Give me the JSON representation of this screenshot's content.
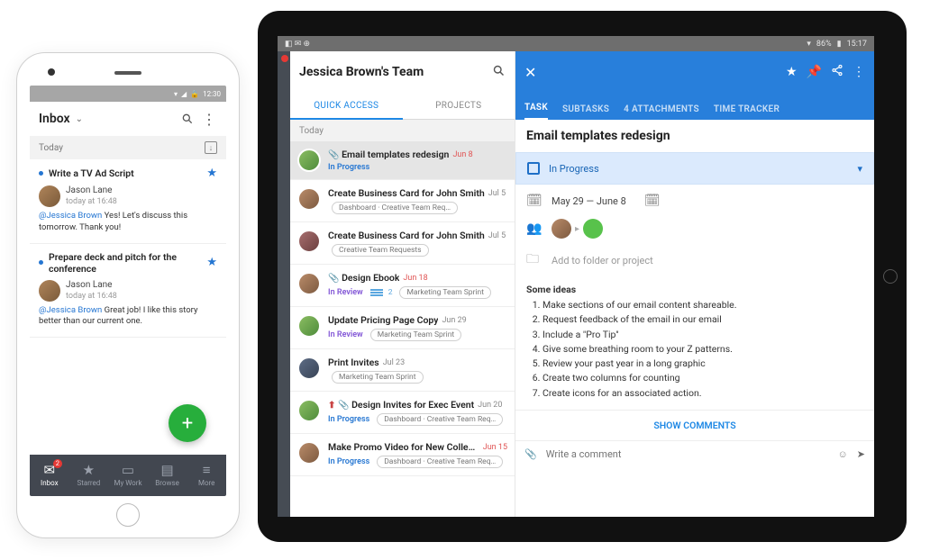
{
  "phone": {
    "status_time": "12:30",
    "header_title": "Inbox",
    "search_icon": "search",
    "more_icon": "more",
    "today_label": "Today",
    "items": [
      {
        "title": "Write a TV Ad Script",
        "author": "Jason Lane",
        "time": "today at 16:48",
        "mention": "@Jessica Brown",
        "message": " Yes! Let's discuss this tomorrow. Thank you!"
      },
      {
        "title": "Prepare deck and pitch for the conference",
        "author": "Jason Lane",
        "time": "today at 16:48",
        "mention": "@Jessica Brown",
        "message": " Great job! I like this story better than our current one."
      }
    ],
    "nav": {
      "inbox": "Inbox",
      "inbox_badge": "2",
      "starred": "Starred",
      "mywork": "My Work",
      "browse": "Browse",
      "more": "More"
    }
  },
  "tablet": {
    "status": {
      "battery": "86%",
      "time": "15:17"
    },
    "team_title": "Jessica Brown's Team",
    "tabs": {
      "quick": "QUICK ACCESS",
      "projects": "PROJECTS"
    },
    "today_label": "Today",
    "tasks": [
      {
        "title": "Email templates redesign",
        "date": "Jun 8",
        "date_red": true,
        "status": "In Progress",
        "status_cls": "inprogress",
        "has_clip": true,
        "avatar": "a1"
      },
      {
        "title": "Create Business Card for John Smith",
        "date": "Jul 5",
        "has_pill": true,
        "pill": "Dashboard · Creative Team Requests",
        "avatar": "a2"
      },
      {
        "title": "Create Business Card for John Smith",
        "date": "Jul 5",
        "has_pill": true,
        "pill": "Creative Team Requests",
        "avatar": "a3"
      },
      {
        "title": "Design Ebook",
        "date": "Jun 18",
        "date_red": true,
        "status": "In Review",
        "status_cls": "inreview",
        "has_clip": true,
        "has_lines": true,
        "lines_count": "2",
        "has_pill": true,
        "pill": "Marketing Team Sprint",
        "avatar": "a2"
      },
      {
        "title": "Update Pricing Page Copy",
        "date": "Jun 29",
        "status": "In Review",
        "status_cls": "inreview",
        "has_pill": true,
        "pill": "Marketing Team Sprint",
        "avatar": "a1"
      },
      {
        "title": "Print Invites",
        "date": "Jul 23",
        "has_pill": true,
        "pill": "Marketing Team Sprint",
        "avatar": "a4"
      },
      {
        "title": "Design Invites for Exec Event",
        "date": "Jun 20",
        "status": "In Progress",
        "status_cls": "inprogress",
        "has_pin": true,
        "has_clip": true,
        "has_pill": true,
        "pill": "Dashboard · Creative Team Requ…",
        "avatar": "a1"
      },
      {
        "title": "Make Promo Video for New Collection",
        "date": "Jun 15",
        "date_red": true,
        "status": "In Progress",
        "status_cls": "inprogress",
        "has_pill": true,
        "pill": "Dashboard · Creative Team Requ…",
        "avatar": "a2"
      }
    ],
    "detail": {
      "tabs": {
        "task": "TASK",
        "subtasks": "SUBTASKS",
        "attachments": "4 ATTACHMENTS",
        "timetracker": "TIME TRACKER"
      },
      "title": "Email templates redesign",
      "status": "In Progress",
      "dates": "May 29 — June 8",
      "folder_placeholder": "Add to folder or project",
      "ideas_header": "Some ideas",
      "ideas": [
        "Make sections of our email content shareable.",
        "Request feedback of the email in our email",
        "Include a \"Pro Tip\"",
        "Give some breathing room to your Z patterns.",
        "Review your past year in a long graphic",
        "Create two columns for counting",
        "Create icons for an associated action."
      ],
      "show_comments": "SHOW COMMENTS",
      "comment_placeholder": "Write a comment"
    }
  }
}
